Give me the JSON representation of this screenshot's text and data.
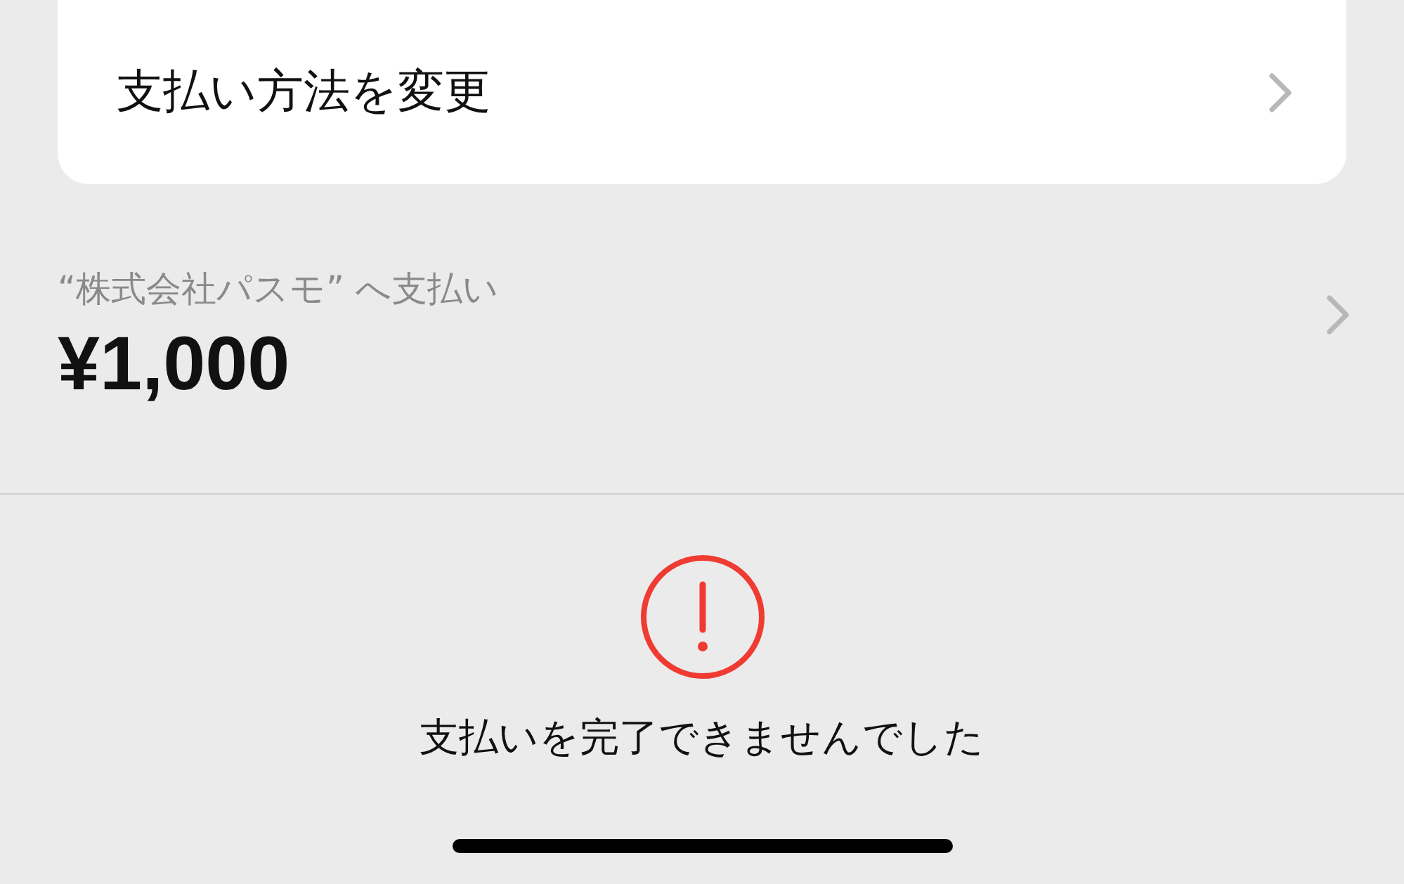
{
  "method_row": {
    "label": "支払い方法を変更"
  },
  "payment": {
    "payee": "“株式会社パスモ” へ支払い",
    "amount": "¥1,000"
  },
  "status": {
    "kind": "error",
    "message": "支払いを完了できませんでした"
  }
}
